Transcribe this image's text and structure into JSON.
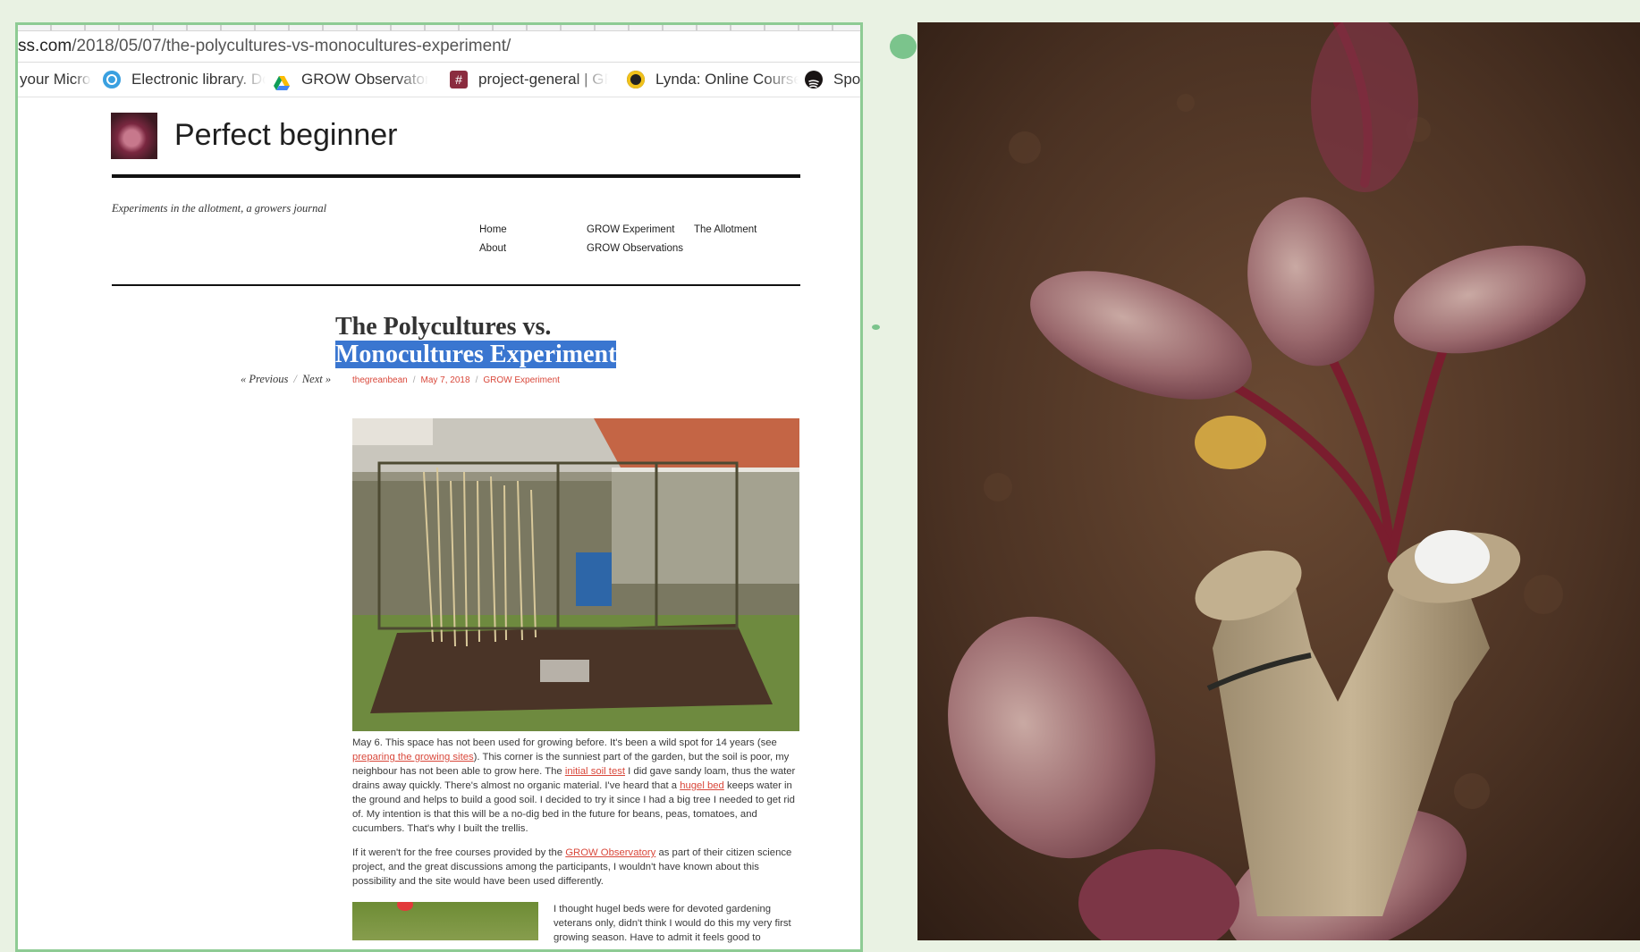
{
  "browser": {
    "url": {
      "host": "ss.com",
      "path": "/2018/05/07/the-polycultures-vs-monocultures-experiment/"
    },
    "bookmarks": [
      {
        "label": "your Micro",
        "icon": "none"
      },
      {
        "label": "Electronic library. Do",
        "icon": "globe-icon"
      },
      {
        "label": "GROW Observatory",
        "icon": "google-drive-icon"
      },
      {
        "label": "project-general | GR",
        "icon": "slack-icon"
      },
      {
        "label": "Lynda: Online Course",
        "icon": "lynda-icon"
      },
      {
        "label": "Spo",
        "icon": "spotify-icon"
      }
    ]
  },
  "site": {
    "title": "Perfect beginner",
    "tagline": "Experiments in the allotment, a growers journal",
    "nav": {
      "home": "Home",
      "about": "About",
      "grow_experiment": "GROW Experiment",
      "grow_observations": "GROW Observations",
      "allotment": "The Allotment"
    }
  },
  "post": {
    "title_line1": "The Polycultures vs.",
    "title_line2": "Monocultures Experiment",
    "prev": "« Previous",
    "next": "Next »",
    "separator": "/",
    "author": "thegreanbean",
    "date": "May 7, 2018",
    "category": "GROW Experiment",
    "p1": {
      "t1": "May 6. This space has not been used for growing before. It's been a wild spot for 14 years (see ",
      "link1": "preparing the growing sites",
      "t2": "). This corner is the sunniest part of the garden, but the soil is poor, my neighbour has not been able to grow here. The ",
      "link2": "initial soil test",
      "t3": " I did gave sandy loam, thus the water drains away quickly. There's almost no organic material. I've heard that a ",
      "link3": "hugel bed",
      "t4": " keeps water in the ground and helps to build a good soil. I decided to try it since I  had a big tree I needed to get rid of. My intention is that this will be a no-dig bed in the future for beans, peas, tomatoes, and cucumbers. That's why I built the trellis."
    },
    "p2": {
      "t1": "If it weren't for the free courses provided by the ",
      "link1": "GROW Observatory",
      "t2": " as part of their citizen science project, and the great discussions among the participants, I wouldn't have known about this possibility and the site would have been used differently."
    },
    "p3": "I thought hugel beds were for devoted gardening veterans only, didn't think I would do this my very first growing season. Have to admit it feels good to"
  },
  "colors": {
    "accent_link": "#d9483b",
    "selection": "#3a76d0",
    "frame_green": "#8ecb94",
    "background": "#e9f2e3"
  }
}
